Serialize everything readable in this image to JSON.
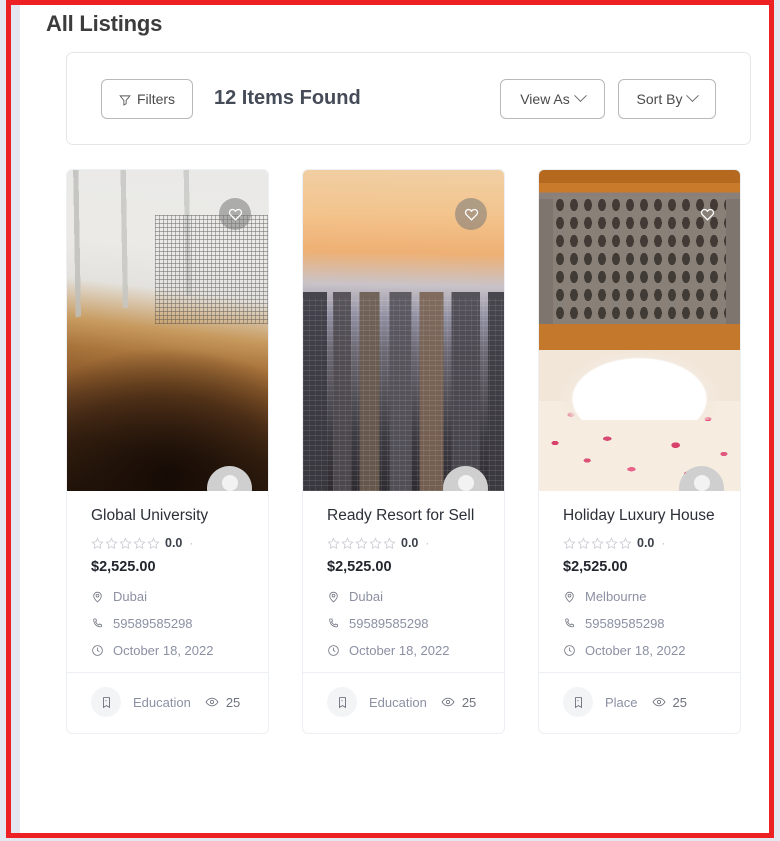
{
  "page": {
    "title": "All Listings",
    "accent_color": "#ed2024"
  },
  "filter_bar": {
    "filters_label": "Filters",
    "items_found": "12 Items Found",
    "view_as_label": "View As",
    "sort_by_label": "Sort By"
  },
  "listings": [
    {
      "title": "Global University",
      "rating": "0.0",
      "price": "$2,525.00",
      "location": "Dubai",
      "phone": "59589585298",
      "date": "October 18, 2022",
      "category": "Education",
      "views": "25",
      "photo": "lecture-hall",
      "favorited": false,
      "fav_style": "circle"
    },
    {
      "title": "Ready Resort for Sell",
      "rating": "0.0",
      "price": "$2,525.00",
      "location": "Dubai",
      "phone": "59589585298",
      "date": "October 18, 2022",
      "category": "Education",
      "views": "25",
      "photo": "city-sunset",
      "favorited": false,
      "fav_style": "circle"
    },
    {
      "title": "Holiday Luxury House",
      "rating": "0.0",
      "price": "$2,525.00",
      "location": "Melbourne",
      "phone": "59589585298",
      "date": "October 18, 2022",
      "category": "Place",
      "views": "25",
      "photo": "hotel-swans",
      "favorited": false,
      "fav_style": "plain"
    }
  ],
  "icons": {
    "filter": "funnel-icon",
    "chevron": "chevron-down-icon",
    "heart": "heart-icon",
    "star": "star-icon",
    "location": "map-pin-icon",
    "phone": "phone-icon",
    "date": "clock-icon",
    "category": "tag-icon",
    "views": "eye-icon",
    "avatar": "avatar-icon"
  }
}
